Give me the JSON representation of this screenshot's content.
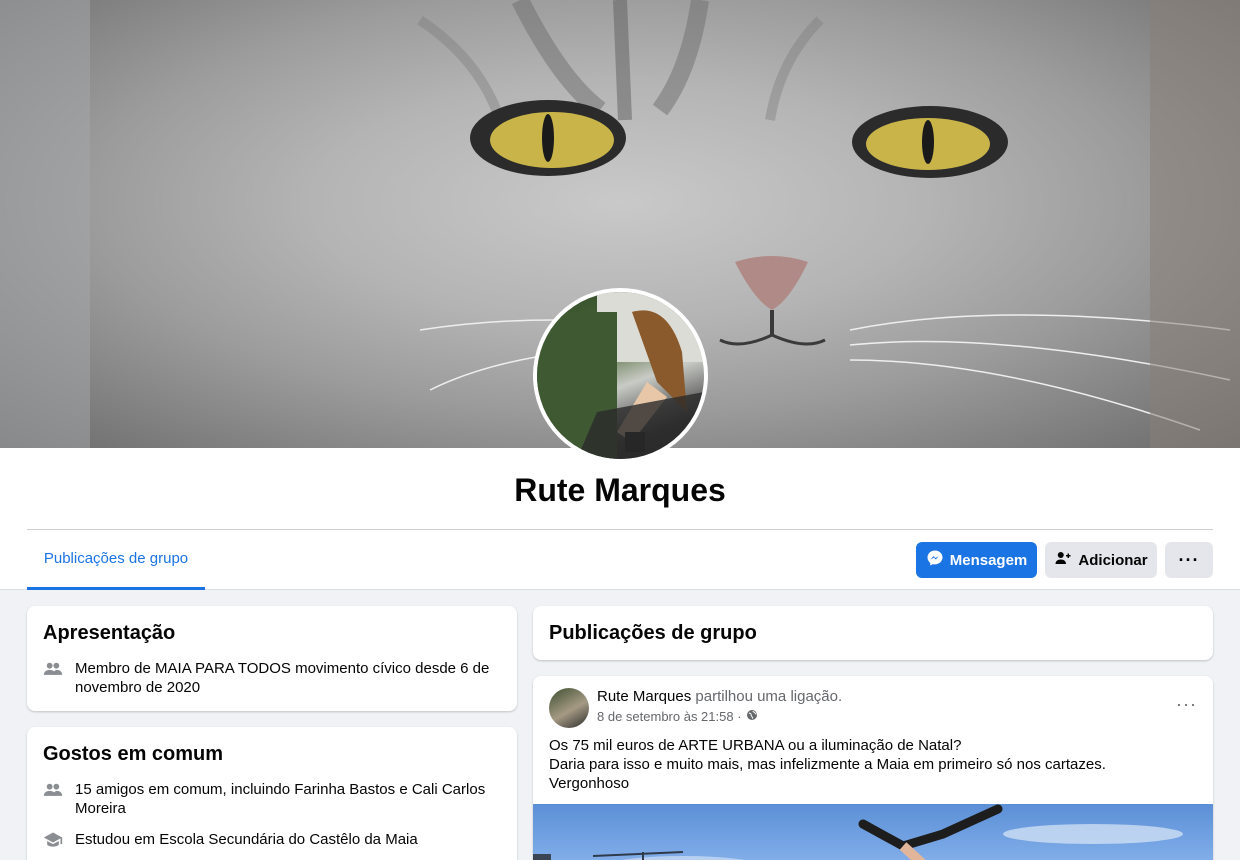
{
  "profile": {
    "name": "Rute Marques"
  },
  "tabs": [
    {
      "label": "Publicações de grupo",
      "active": true
    }
  ],
  "actions": {
    "message_label": "Mensagem",
    "add_label": "Adicionar",
    "more_label": "···"
  },
  "intro": {
    "title": "Apresentação",
    "member_prefix": "Membro de ",
    "group_name": "MAIA PARA TODOS movimento cívico",
    "member_suffix": " desde 6 de novembro de 2020"
  },
  "likes": {
    "title": "Gostos em comum",
    "friends_prefix": "15 amigos em comum, incluindo ",
    "friend1": "Farinha Bastos",
    "friends_and": " e ",
    "friend2": "Cali Carlos Moreira",
    "school_prefix": "Estudou em ",
    "school": "Escola Secundária do Castêlo da Maia"
  },
  "group_posts": {
    "title": "Publicações de grupo"
  },
  "post": {
    "author": "Rute Marques",
    "action": " partilhou uma ligação.",
    "date": "8 de setembro às 21:58 ·",
    "more_label": "···",
    "text_line1": "Os 75 mil euros de ARTE URBANA ou a iluminação de Natal?",
    "text_line2": "Daria para isso e muito mais, mas infelizmente a Maia em primeiro só nos cartazes.",
    "text_line3": "Vergonhoso"
  },
  "colors": {
    "accent": "#1b74e4",
    "button_secondary": "#e4e6eb",
    "background": "#f0f2f5"
  },
  "icons": [
    "messenger-icon",
    "add-friend-icon",
    "group-icon",
    "graduation-cap-icon",
    "globe-icon"
  ]
}
